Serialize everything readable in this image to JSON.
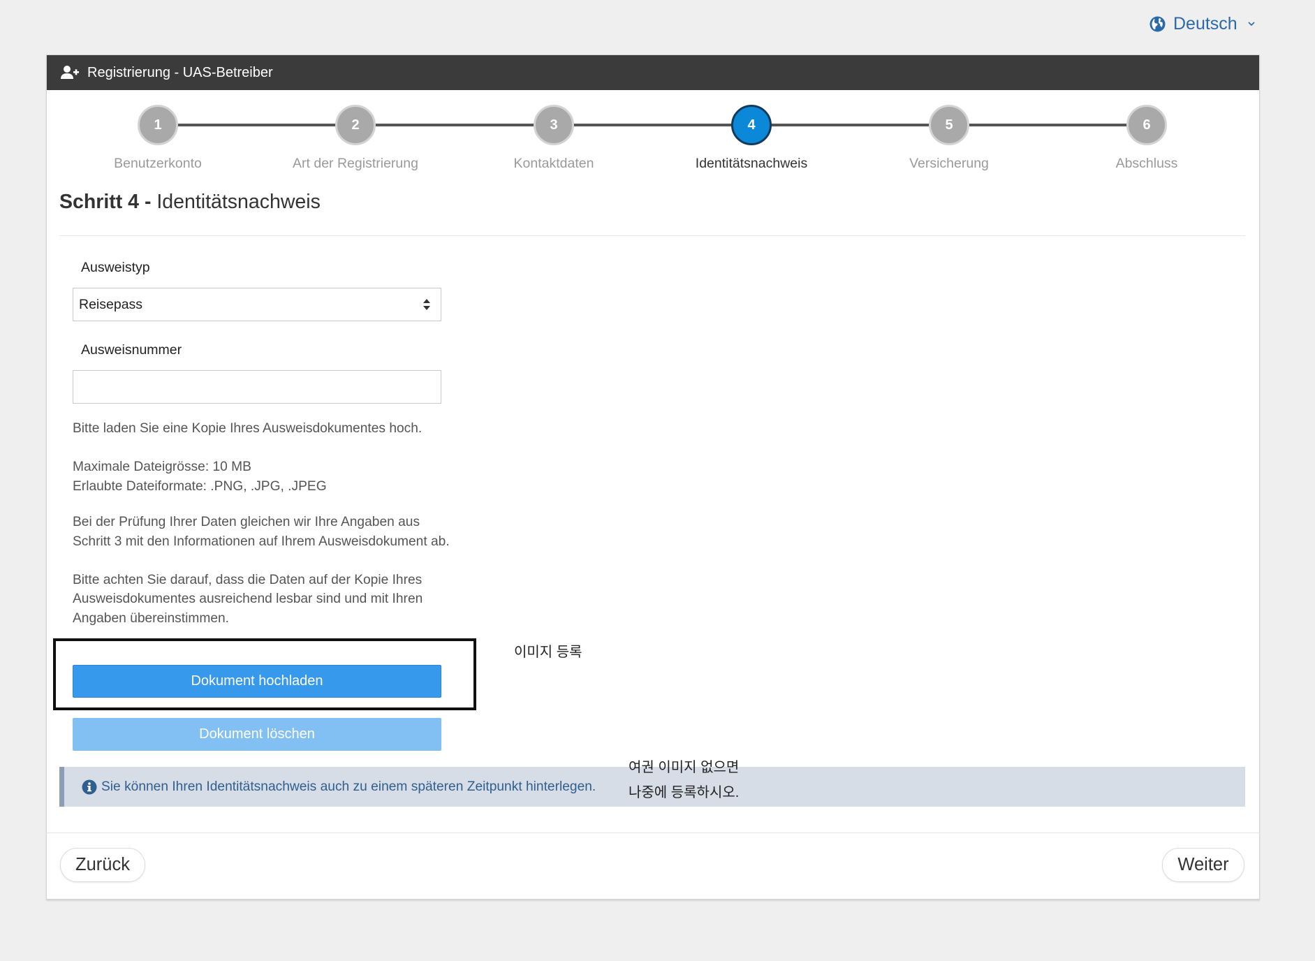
{
  "language": {
    "label": "Deutsch"
  },
  "header": {
    "title": "Registrierung - UAS-Betreiber"
  },
  "steps": [
    {
      "number": "1",
      "label": "Benutzerkonto",
      "active": false
    },
    {
      "number": "2",
      "label": "Art der Registrierung",
      "active": false
    },
    {
      "number": "3",
      "label": "Kontaktdaten",
      "active": false
    },
    {
      "number": "4",
      "label": "Identitätsnachweis",
      "active": true
    },
    {
      "number": "5",
      "label": "Versicherung",
      "active": false
    },
    {
      "number": "6",
      "label": "Abschluss",
      "active": false
    }
  ],
  "section": {
    "step_prefix": "Schritt 4 -",
    "title": "Identitätsnachweis"
  },
  "form": {
    "id_type": {
      "label": "Ausweistyp",
      "value": "Reisepass"
    },
    "id_number": {
      "label": "Ausweisnummer",
      "value": ""
    }
  },
  "upload_info": {
    "intro": "Bitte laden Sie eine Kopie Ihres Ausweisdokumentes hoch.",
    "max_size": "Maximale Dateigrösse: 10 MB",
    "formats": "Erlaubte Dateiformate: .PNG, .JPG, .JPEG",
    "check_note": "Bei der Prüfung Ihrer Daten gleichen wir Ihre Angaben aus Schritt 3 mit den Informationen auf Ihrem Ausweisdokument ab.",
    "readability_note": "Bitte achten Sie darauf, dass die Daten auf der Kopie Ihres Ausweisdokumentes ausreichend lesbar sind und mit Ihren Angaben übereinstimmen."
  },
  "buttons": {
    "upload": "Dokument hochladen",
    "delete": "Dokument löschen",
    "back": "Zurück",
    "next": "Weiter"
  },
  "alert": {
    "text": "Sie können Ihren Identitätsnachweis auch zu einem späteren Zeitpunkt hinterlegen."
  },
  "annotations": {
    "upload_note": "이미지 등록",
    "later_note_line1": "여권 이미지 없으면",
    "later_note_line2": "나중에 등록하시오."
  },
  "icons": {
    "language": "globe-icon",
    "language_dropdown": "chevron-down-icon",
    "header": "user-plus-icon",
    "select": "sort-arrows-icon",
    "alert": "info-icon"
  },
  "colors": {
    "accent": "#0b88d8",
    "header_bg": "#3b3b3b",
    "primary_button": "#3799eb",
    "disabled_button": "#82c0f3",
    "alert_bg": "#d6dde6",
    "alert_text": "#2f5f8f",
    "link": "#2b6aa8"
  }
}
